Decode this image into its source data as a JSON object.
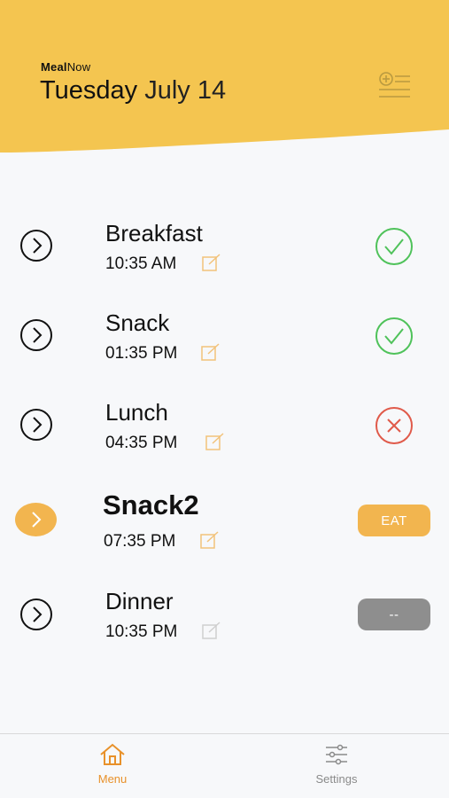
{
  "header": {
    "brand_bold": "Meal",
    "brand_regular": "Now",
    "day": "Tuesday",
    "date": "July 14",
    "accent_color": "#f4c550"
  },
  "meals": [
    {
      "name": "Breakfast",
      "time": "10:35 AM",
      "status": "done"
    },
    {
      "name": "Snack",
      "time": "01:35 PM",
      "status": "done"
    },
    {
      "name": "Lunch",
      "time": "04:35 PM",
      "status": "missed"
    },
    {
      "name": "Snack2",
      "time": "07:35 PM",
      "status": "current",
      "button_label": "EAT"
    },
    {
      "name": "Dinner",
      "time": "10:35 PM",
      "status": "upcoming",
      "button_label": "--"
    }
  ],
  "tabs": {
    "menu": {
      "label": "Menu",
      "icon": "home-icon"
    },
    "settings": {
      "label": "Settings",
      "icon": "sliders-icon"
    }
  },
  "colors": {
    "done": "#4fc25a",
    "missed": "#e05a4a",
    "eat": "#f2b54f",
    "upcoming": "#8e8e8e"
  }
}
